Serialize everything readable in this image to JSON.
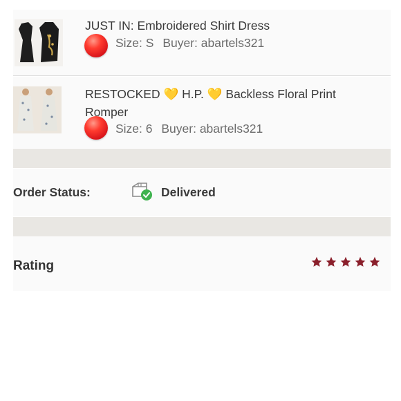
{
  "items": [
    {
      "title": "JUST IN: Embroidered Shirt Dress",
      "size": "Size: S",
      "buyer": "Buyer: abartels321",
      "status_dot_color": "#e8202a"
    },
    {
      "title": "RESTOCKED 💛 H.P. 💛 Backless Floral Print Romper",
      "size": "Size: 6",
      "buyer": "Buyer: abartels321",
      "status_dot_color": "#e8202a"
    }
  ],
  "order_status": {
    "label": "Order Status:",
    "value": "Delivered",
    "icon": "package-delivered-icon",
    "check_color": "#3fb34f"
  },
  "rating": {
    "label": "Rating",
    "stars": 5,
    "max_stars": 5,
    "star_color": "#8a1f2b"
  }
}
